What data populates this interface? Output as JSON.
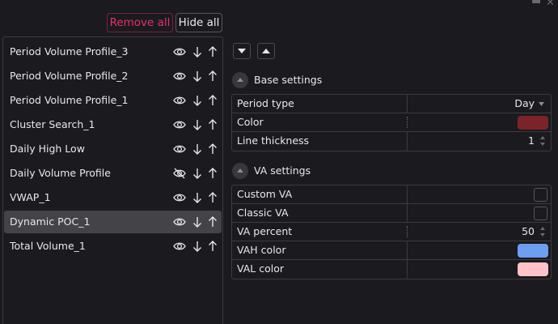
{
  "window": {
    "minimize_icon": "minimize-icon",
    "close_icon": "close-icon",
    "min_glyph": "▬",
    "close_glyph": "✕"
  },
  "toolbar": {
    "remove_all_label": "Remove all",
    "hide_all_label": "Hide all",
    "remove_all_color": "#e8306a"
  },
  "indicators": [
    {
      "name": "Period Volume Profile_3",
      "visible": true,
      "selected": false
    },
    {
      "name": "Period Volume Profile_2",
      "visible": true,
      "selected": false
    },
    {
      "name": "Period Volume Profile_1",
      "visible": true,
      "selected": false
    },
    {
      "name": "Cluster Search_1",
      "visible": true,
      "selected": false
    },
    {
      "name": "Daily High Low",
      "visible": true,
      "selected": false
    },
    {
      "name": "Daily Volume Profile",
      "visible": false,
      "selected": false
    },
    {
      "name": "VWAP_1",
      "visible": true,
      "selected": false
    },
    {
      "name": "Dynamic POC_1",
      "visible": true,
      "selected": true
    },
    {
      "name": "Total Volume_1",
      "visible": true,
      "selected": false
    }
  ],
  "settings": {
    "expand_icon": "chevron-down-icon",
    "collapse_icon": "chevron-up-icon",
    "base": {
      "title": "Base settings",
      "period_type_label": "Period type",
      "period_type_value": "Day",
      "color_label": "Color",
      "color_value": "#7a2428",
      "line_thickness_label": "Line thickness",
      "line_thickness_value": "1"
    },
    "va": {
      "title": "VA settings",
      "custom_va_label": "Custom VA",
      "custom_va_checked": false,
      "classic_va_label": "Classic VA",
      "classic_va_checked": false,
      "va_percent_label": "VA percent",
      "va_percent_value": "50",
      "vah_color_label": "VAH color",
      "vah_color_value": "#6d9ef0",
      "val_color_label": "VAL color",
      "val_color_value": "#ffc2c8"
    }
  }
}
